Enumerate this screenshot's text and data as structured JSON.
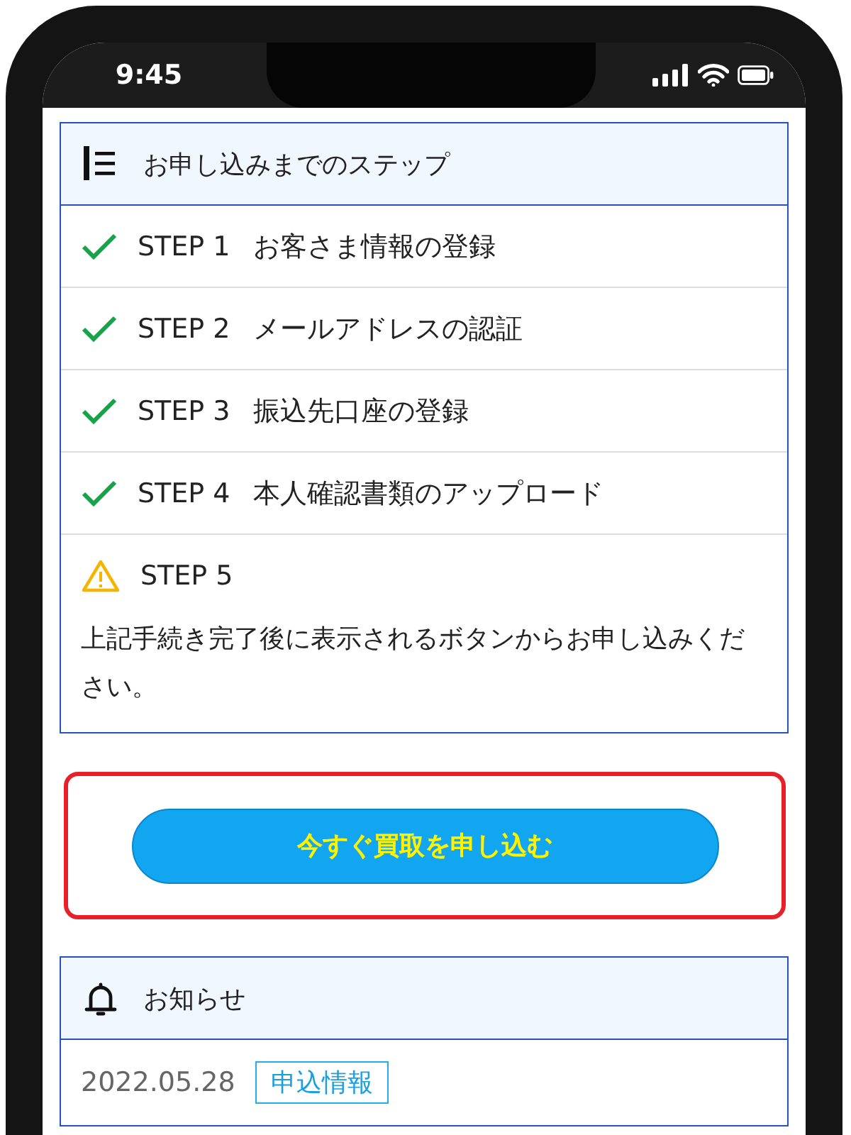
{
  "status_bar": {
    "time": "9:45"
  },
  "steps_card": {
    "title": "お申し込みまでのステップ",
    "steps": [
      {
        "kind": "done",
        "label": "STEP 1",
        "text": "お客さま情報の登録"
      },
      {
        "kind": "done",
        "label": "STEP 2",
        "text": "メールアドレスの認証"
      },
      {
        "kind": "done",
        "label": "STEP 3",
        "text": "振込先口座の登録"
      },
      {
        "kind": "done",
        "label": "STEP 4",
        "text": "本人確認書類のアップロード"
      },
      {
        "kind": "warning",
        "label": "STEP 5",
        "note": "上記手続き完了後に表示されるボタンからお申し込みください。"
      }
    ]
  },
  "apply_button": "今すぐ買取を申し込む",
  "notice_card": {
    "title": "お知らせ",
    "date": "2022.05.28",
    "tag": "申込情報"
  }
}
